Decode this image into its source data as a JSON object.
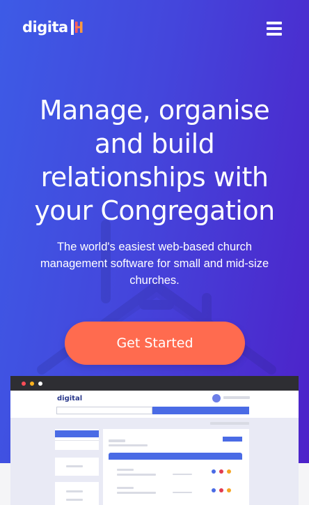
{
  "brand": {
    "logo_text": "digita",
    "logo_mark": "H"
  },
  "nav": {
    "menu_icon": "hamburger-menu-icon"
  },
  "hero": {
    "headline_lines": [
      "Manage, organise",
      "and build",
      "relationships with",
      "your Congregation"
    ],
    "subtext_lines": [
      "The world's easiest web-based church",
      "management software for small and mid-size",
      "churches."
    ],
    "cta_label": "Get Started"
  },
  "preview": {
    "logo_text": "digital"
  },
  "colors": {
    "gradient_start": "#3d5be6",
    "gradient_end": "#4d22c9",
    "cta": "#ff6b4f",
    "logo_mark_left": "#ff5a5f",
    "logo_mark_right": "#ff9a3c"
  }
}
